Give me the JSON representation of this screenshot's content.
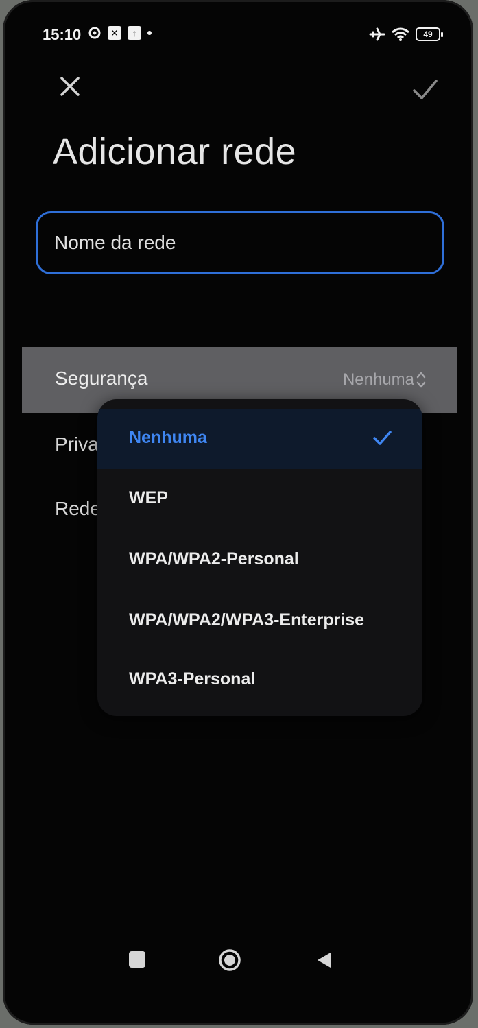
{
  "status_bar": {
    "time": "15:10",
    "battery": "49",
    "left_icons": [
      "gear-status-icon",
      "box-x-icon",
      "box-up-icon",
      "dot-icon"
    ],
    "right_icons": [
      "airplane-icon",
      "wifi-icon",
      "battery-icon"
    ]
  },
  "header": {
    "title": "Adicionar rede",
    "close_icon": "close-icon",
    "confirm_icon": "checkmark-icon"
  },
  "form": {
    "name_placeholder": "Nome da rede",
    "security_label": "Segurança",
    "security_value": "Nenhuma",
    "privacy_label_visible": "Priva",
    "network_label_visible": "Rede"
  },
  "dropdown": {
    "options": [
      {
        "label": "Nenhuma",
        "selected": true
      },
      {
        "label": "WEP",
        "selected": false
      },
      {
        "label": "WPA/WPA2-Personal",
        "selected": false
      },
      {
        "label": "WPA/WPA2/WPA3-Enterprise",
        "selected": false
      },
      {
        "label": "WPA3-Personal",
        "selected": false
      }
    ]
  },
  "colors": {
    "accent": "#3f86f2",
    "field_border": "#2f6fd8",
    "background": "#050505",
    "row_highlight": "#5f5f62"
  },
  "nav_bar": {
    "items": [
      "recents-icon",
      "home-icon",
      "back-icon"
    ]
  }
}
